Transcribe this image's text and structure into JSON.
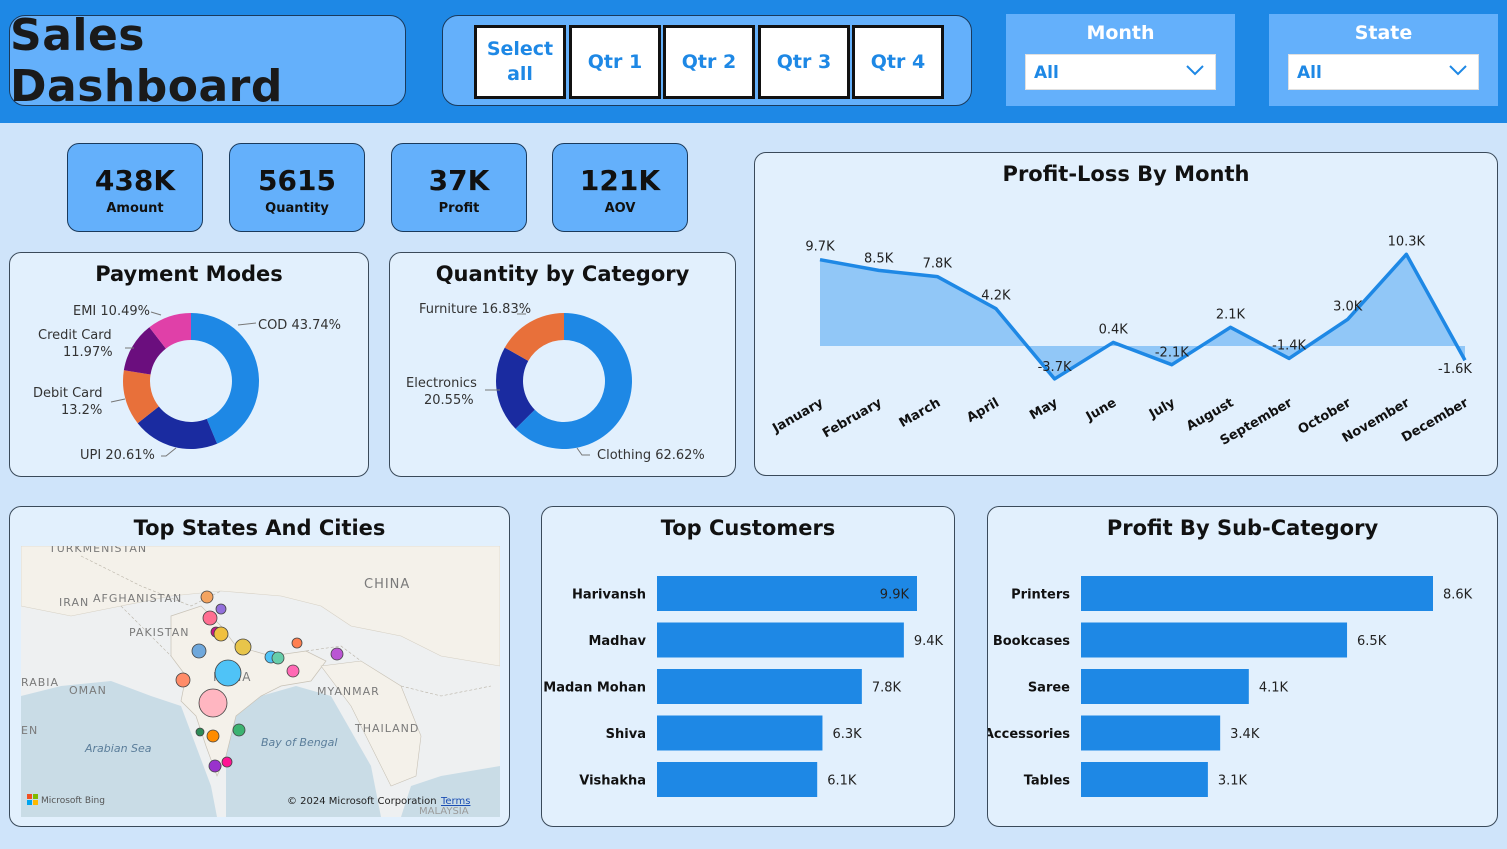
{
  "header": {
    "title": "Sales Dashboard",
    "quarters": [
      "Select all",
      "Qtr 1",
      "Qtr 2",
      "Qtr 3",
      "Qtr 4"
    ],
    "month_filter": {
      "label": "Month",
      "value": "All"
    },
    "state_filter": {
      "label": "State",
      "value": "All"
    }
  },
  "kpis": [
    {
      "value": "438K",
      "label": "Amount"
    },
    {
      "value": "5615",
      "label": "Quantity"
    },
    {
      "value": "37K",
      "label": "Profit"
    },
    {
      "value": "121K",
      "label": "AOV"
    }
  ],
  "colors": {
    "primary": "#1e88e5",
    "header": "#1e88e5",
    "tile": "#64b0fb",
    "card_bg": "#e2f0fd",
    "page_bg": "#cfe4fa"
  },
  "map": {
    "title": "Top States And Cities",
    "labels": [
      "TURKMENISTAN",
      "AFGHANISTAN",
      "IRAN",
      "PAKISTAN",
      "CHINA",
      "INDIA",
      "MYANMAR",
      "THAILAND",
      "OMAN",
      "RABIA",
      "EN",
      "Arabian Sea",
      "Bay of Bengal",
      "MALAYSIA"
    ],
    "attribution": "Microsoft Bing",
    "copyright": "© 2024 Microsoft Corporation",
    "terms": "Terms"
  },
  "chart_data": [
    {
      "type": "pie",
      "title": "Payment Modes",
      "donut": true,
      "slices": [
        {
          "name": "COD",
          "value": 43.74,
          "label": "COD 43.74%",
          "color": "#1e88e5"
        },
        {
          "name": "UPI",
          "value": 20.61,
          "label": "UPI 20.61%",
          "color": "#1a2ba0"
        },
        {
          "name": "Debit Card",
          "value": 13.2,
          "label1": "Debit Card",
          "label2": "13.2%",
          "color": "#e8703a"
        },
        {
          "name": "Credit Card",
          "value": 11.97,
          "label1": "Credit Card",
          "label2": "11.97%",
          "color": "#6b0e7e"
        },
        {
          "name": "EMI",
          "value": 10.49,
          "label": "EMI 10.49%",
          "color": "#e040a8"
        }
      ]
    },
    {
      "type": "pie",
      "title": "Quantity by Category",
      "donut": true,
      "slices": [
        {
          "name": "Clothing",
          "value": 62.62,
          "label": "Clothing 62.62%",
          "color": "#1e88e5"
        },
        {
          "name": "Electronics",
          "value": 20.55,
          "label1": "Electronics",
          "label2": "20.55%",
          "color": "#1a2ba0"
        },
        {
          "name": "Furniture",
          "value": 16.83,
          "label": "Furniture 16.83%",
          "color": "#e8703a"
        }
      ]
    },
    {
      "type": "area",
      "title": "Profit-Loss By Month",
      "categories": [
        "January",
        "February",
        "March",
        "April",
        "May",
        "June",
        "July",
        "August",
        "September",
        "October",
        "November",
        "December"
      ],
      "values": [
        9.7,
        8.5,
        7.8,
        4.2,
        -3.7,
        0.4,
        -2.1,
        2.1,
        -1.4,
        3.0,
        10.3,
        -1.6
      ],
      "value_labels": [
        "9.7K",
        "8.5K",
        "7.8K",
        "4.2K",
        "-3.7K",
        "0.4K",
        "-2.1K",
        "2.1K",
        "-1.4K",
        "3.0K",
        "10.3K",
        "-1.6K"
      ],
      "unit": "K",
      "grid": false
    },
    {
      "type": "bar",
      "orientation": "horizontal",
      "title": "Top Customers",
      "categories": [
        "Harivansh",
        "Madhav",
        "Madan Mohan",
        "Shiva",
        "Vishakha"
      ],
      "values": [
        9.9,
        9.4,
        7.8,
        6.3,
        6.1
      ],
      "value_labels": [
        "9.9K",
        "9.4K",
        "7.8K",
        "6.3K",
        "6.1K"
      ]
    },
    {
      "type": "bar",
      "orientation": "horizontal",
      "title": "Profit By Sub-Category",
      "categories": [
        "Printers",
        "Bookcases",
        "Saree",
        "Accessories",
        "Tables"
      ],
      "values": [
        8.6,
        6.5,
        4.1,
        3.4,
        3.1
      ],
      "value_labels": [
        "8.6K",
        "6.5K",
        "4.1K",
        "3.4K",
        "3.1K"
      ]
    }
  ]
}
